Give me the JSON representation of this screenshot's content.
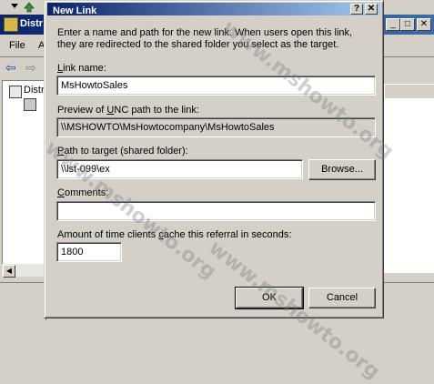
{
  "background_window": {
    "title": "Distr",
    "menu": [
      "File",
      "A"
    ],
    "tree_item": "Distr",
    "controls": [
      "_",
      "□",
      "✕"
    ]
  },
  "dialog": {
    "title": "New Link",
    "title_buttons": {
      "help": "?",
      "close": "✕"
    },
    "description": "Enter a name and path for the new link. When users open this link, they are redirected to the shared folder you select as the target.",
    "link_name": {
      "label_pre": "",
      "label_accel": "L",
      "label_post": "ink name:",
      "value": "MsHowtoSales"
    },
    "unc_preview": {
      "label_pre": "Preview of ",
      "label_accel": "U",
      "label_post": "NC path to the link:",
      "value": "\\\\MSHOWTO\\MsHowtocompany\\MsHowtoSales"
    },
    "target": {
      "label_pre": "",
      "label_accel": "P",
      "label_post": "ath to target (shared folder):",
      "value": "\\\\lst-099\\ex",
      "browse_label": "Browse..."
    },
    "comments": {
      "label_pre": "",
      "label_accel": "C",
      "label_post": "omments:",
      "value": ""
    },
    "cache": {
      "label_pre": "Amount of time clients ",
      "label_accel": "c",
      "label_post": "ache this referral in seconds:",
      "value": "1800"
    },
    "ok_label": "OK",
    "cancel_label": "Cancel"
  },
  "watermark": "www.mshowto.org"
}
